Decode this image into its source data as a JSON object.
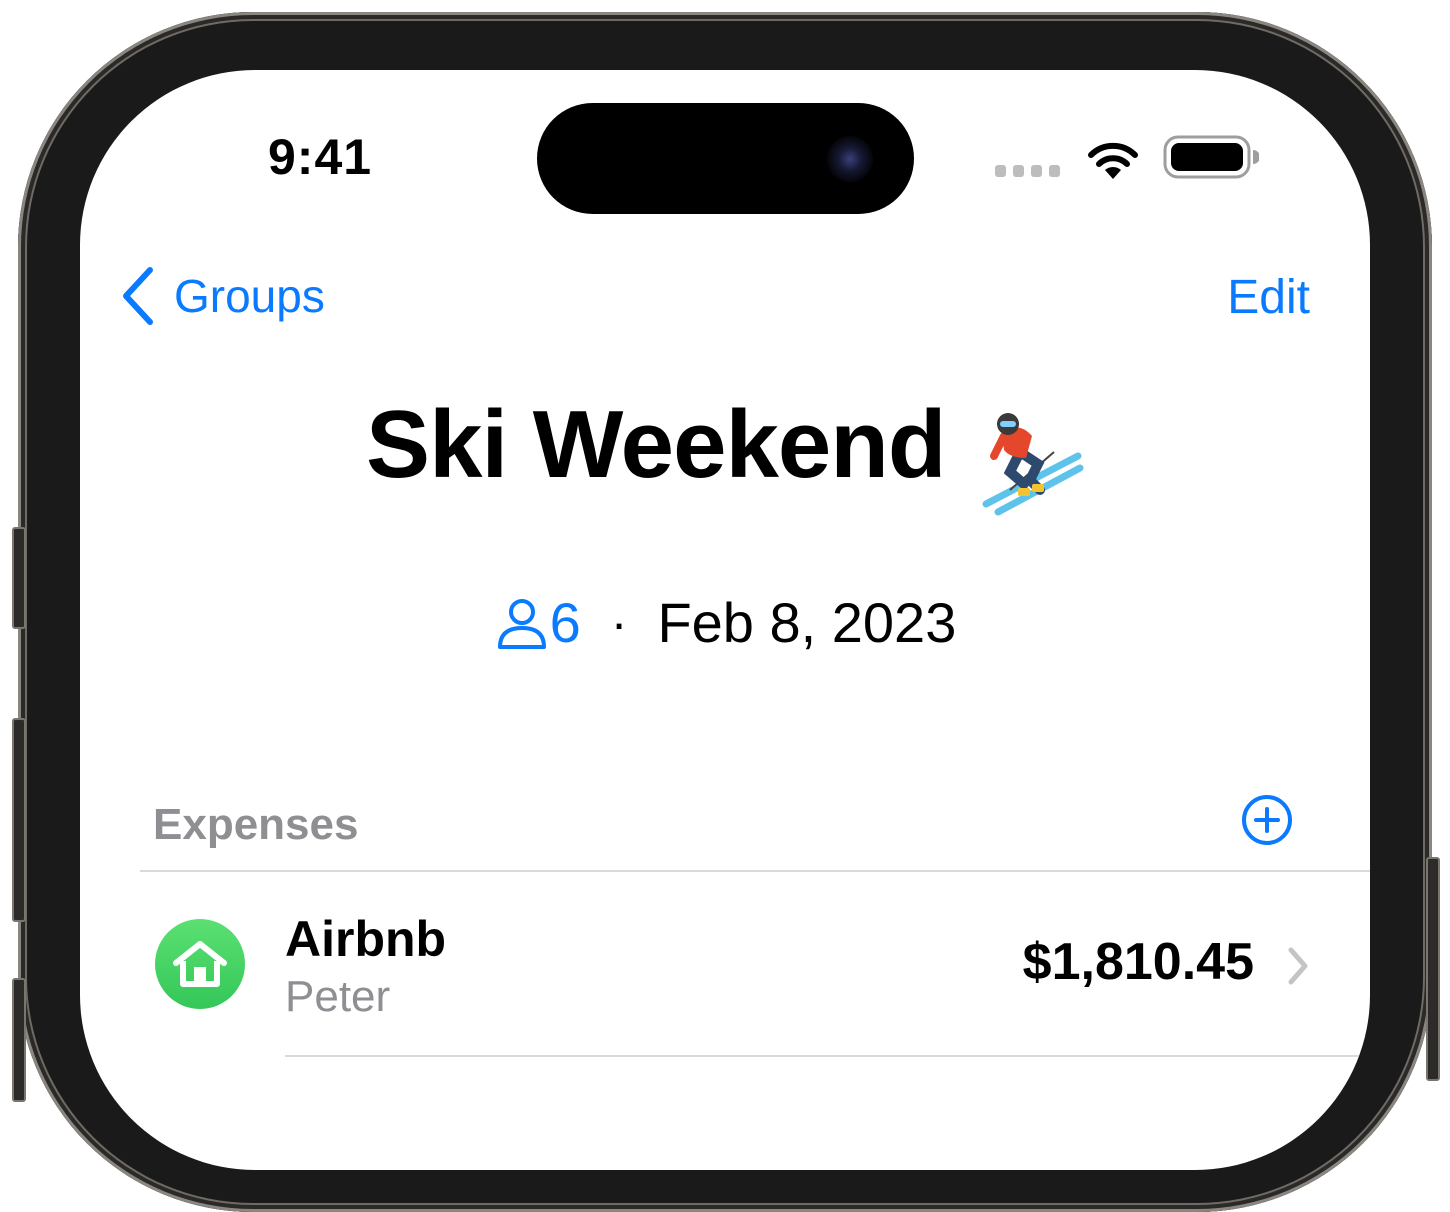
{
  "status_bar": {
    "time": "9:41"
  },
  "nav": {
    "back_label": "Groups",
    "edit_label": "Edit"
  },
  "group": {
    "title": "Ski Weekend",
    "member_count": "6",
    "separator": "·",
    "date": "Feb 8, 2023"
  },
  "expenses": {
    "section_title": "Expenses",
    "items": [
      {
        "title": "Airbnb",
        "payer": "Peter",
        "amount": "$1,810.45",
        "icon": "house-icon"
      }
    ]
  },
  "colors": {
    "accent": "#0a7aff",
    "secondary_text": "#8e8e93",
    "icon_green": "#34c759"
  }
}
